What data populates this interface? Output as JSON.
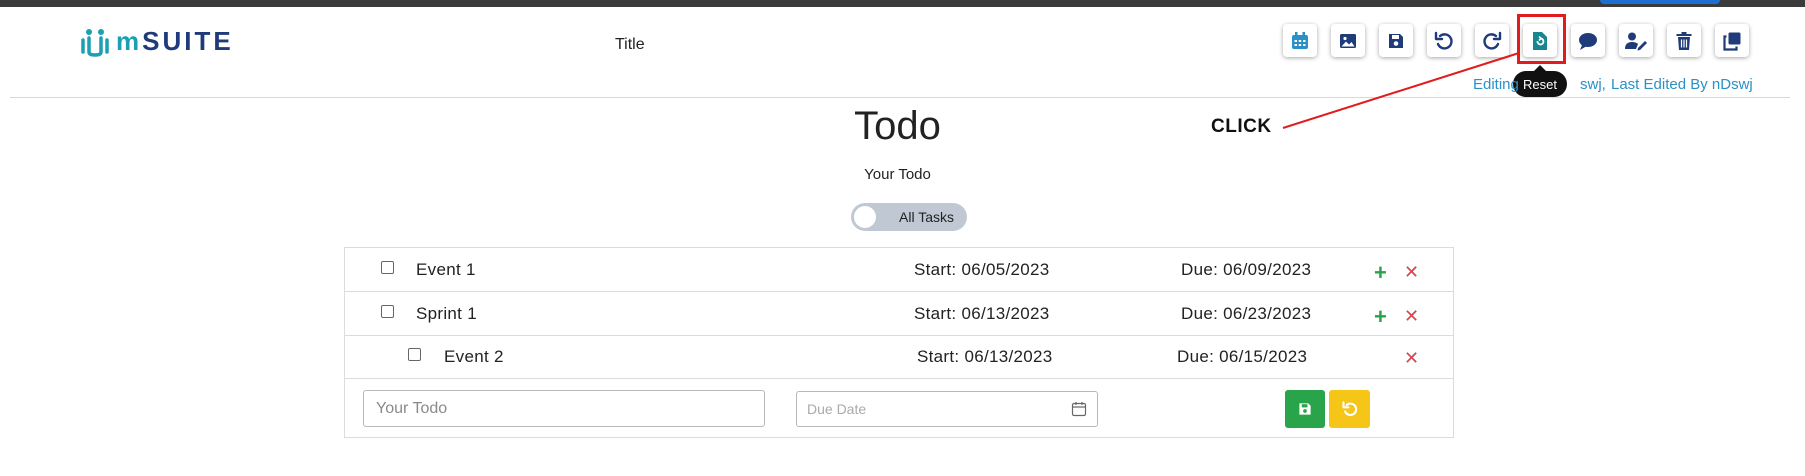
{
  "app": {
    "logo_text": "SUITE",
    "logo_prefix": "m"
  },
  "header": {
    "title": "Title"
  },
  "toolbar": {
    "buttons": [
      {
        "name": "calendar",
        "icon": "calendar-icon"
      },
      {
        "name": "image",
        "icon": "image-icon"
      },
      {
        "name": "save",
        "icon": "save-icon"
      },
      {
        "name": "undo",
        "icon": "undo-icon"
      },
      {
        "name": "redo",
        "icon": "redo-icon"
      },
      {
        "name": "reset",
        "icon": "reset-icon"
      },
      {
        "name": "comment",
        "icon": "comment-icon"
      },
      {
        "name": "user-edit",
        "icon": "user-edit-icon"
      },
      {
        "name": "delete",
        "icon": "trash-icon"
      },
      {
        "name": "duplicate",
        "icon": "copy-icon"
      }
    ],
    "tooltip": "Reset"
  },
  "edit_info": {
    "editing": "Editing",
    "editing_user_suffix": "swj,",
    "last_edited": "Last Edited By nDswj"
  },
  "annotation": {
    "label": "CLICK",
    "color": "#e01c1c"
  },
  "todo": {
    "title": "Todo",
    "subtitle": "Your Todo",
    "toggle_label": "All Tasks",
    "rows": [
      {
        "name": "Event 1",
        "start": "Start: 06/05/2023",
        "due": "Due: 06/09/2023",
        "can_add": true
      },
      {
        "name": "Sprint 1",
        "start": "Start: 06/13/2023",
        "due": "Due: 06/23/2023",
        "can_add": true
      },
      {
        "name": "Event 2",
        "start": "Start: 06/13/2023",
        "due": "Due: 06/15/2023",
        "can_add": false
      }
    ],
    "add_symbol": "+",
    "remove_symbol": "✕",
    "new_todo_placeholder": "Your Todo",
    "due_date_placeholder": "Due Date"
  },
  "colors": {
    "primary": "#1f3b79",
    "accent": "#1a9fb3",
    "save": "#2aa44a",
    "reset": "#f5c518",
    "delete": "#d9434a"
  }
}
